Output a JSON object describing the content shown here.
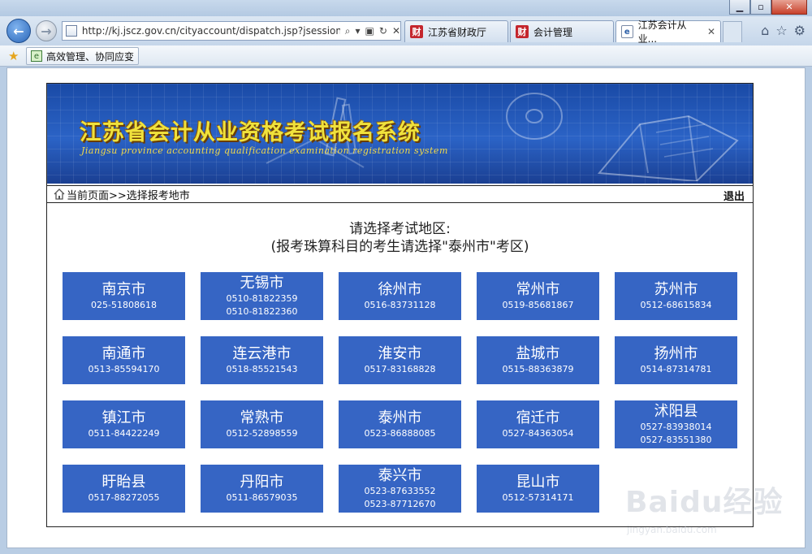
{
  "browser": {
    "address": "http://kj.jscz.gov.cn/cityaccount/dispatch.jsp?jsessionid:",
    "tabs": [
      {
        "label": "江苏省财政厅",
        "icon": "jscz-logo-icon",
        "active": false
      },
      {
        "label": "会计管理",
        "icon": "jscz-logo-icon",
        "active": false
      },
      {
        "label": "江苏会计从业...",
        "icon": "page-icon",
        "active": true
      }
    ],
    "favorites": [
      {
        "label": "高效管理、协同应变"
      }
    ]
  },
  "header": {
    "title": "江苏省会计从业资格考试报名系统",
    "subtitle": "Jiangsu province accounting qualification examination registration system"
  },
  "breadcrumb": {
    "text": "当前页面>>选择报考地市",
    "logout": "退出"
  },
  "prompt": {
    "line1": "请选择考试地区:",
    "line2": "(报考珠算科目的考生请选择\"泰州市\"考区)"
  },
  "cities": [
    {
      "name": "南京市",
      "phones": [
        "025-51808618"
      ]
    },
    {
      "name": "无锡市",
      "phones": [
        "0510-81822359",
        "0510-81822360"
      ]
    },
    {
      "name": "徐州市",
      "phones": [
        "0516-83731128"
      ]
    },
    {
      "name": "常州市",
      "phones": [
        "0519-85681867"
      ]
    },
    {
      "name": "苏州市",
      "phones": [
        "0512-68615834"
      ]
    },
    {
      "name": "南通市",
      "phones": [
        "0513-85594170"
      ]
    },
    {
      "name": "连云港市",
      "phones": [
        "0518-85521543"
      ]
    },
    {
      "name": "淮安市",
      "phones": [
        "0517-83168828"
      ]
    },
    {
      "name": "盐城市",
      "phones": [
        "0515-88363879"
      ]
    },
    {
      "name": "扬州市",
      "phones": [
        "0514-87314781"
      ]
    },
    {
      "name": "镇江市",
      "phones": [
        "0511-84422249"
      ]
    },
    {
      "name": "常熟市",
      "phones": [
        "0512-52898559"
      ]
    },
    {
      "name": "泰州市",
      "phones": [
        "0523-86888085"
      ]
    },
    {
      "name": "宿迁市",
      "phones": [
        "0527-84363054"
      ]
    },
    {
      "name": "沭阳县",
      "phones": [
        "0527-83938014",
        "0527-83551380"
      ]
    },
    {
      "name": "盱眙县",
      "phones": [
        "0517-88272055"
      ]
    },
    {
      "name": "丹阳市",
      "phones": [
        "0511-86579035"
      ]
    },
    {
      "name": "泰兴市",
      "phones": [
        "0523-87633552",
        "0523-87712670"
      ]
    },
    {
      "name": "昆山市",
      "phones": [
        "0512-57314171"
      ]
    }
  ],
  "watermark": {
    "brand": "Baidu经验",
    "url": "jingyan.baidu.com"
  },
  "colors": {
    "tile": "#3665c4",
    "banner": "#2b63c6",
    "title_yellow": "#f0e23c"
  }
}
